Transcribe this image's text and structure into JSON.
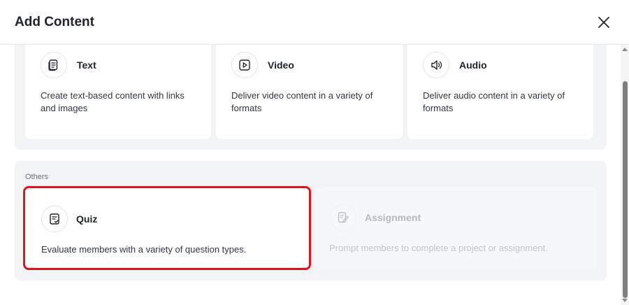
{
  "dialog": {
    "title": "Add Content",
    "close_icon": "close-icon"
  },
  "content_types": [
    {
      "label": "Text",
      "description": "Create text-based content with links and images",
      "icon": "text-document-icon"
    },
    {
      "label": "Video",
      "description": "Deliver video content in a variety of formats",
      "icon": "video-play-icon"
    },
    {
      "label": "Audio",
      "description": "Deliver audio content in a variety of formats",
      "icon": "speaker-icon"
    }
  ],
  "others": {
    "label": "Others",
    "items": [
      {
        "label": "Quiz",
        "description": "Evaluate members with a variety of question types.",
        "icon": "quiz-checklist-icon",
        "state": "highlighted"
      },
      {
        "label": "Assignment",
        "description": "Prompt members to complete a project or assignment.",
        "icon": "assignment-edit-icon",
        "state": "disabled"
      }
    ]
  },
  "colors": {
    "highlight_border": "#e0141c",
    "group_background": "#f2f3f4",
    "disabled_text": "#b6b9bd"
  }
}
